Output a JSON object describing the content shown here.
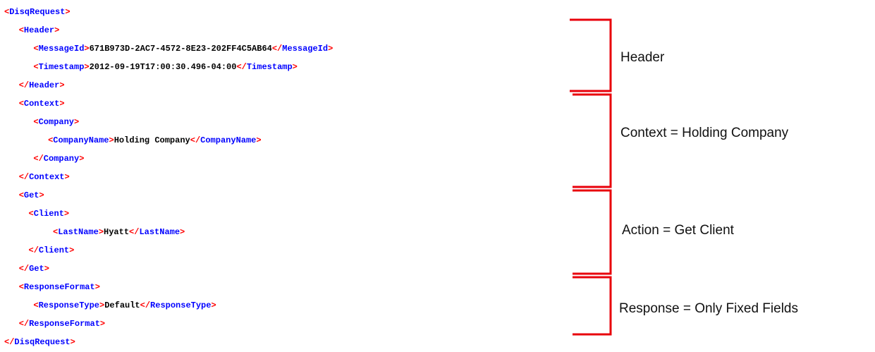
{
  "xml_lines": [
    {
      "indent": 0,
      "parts": [
        [
          "b",
          "<"
        ],
        [
          "t",
          "DisqRequest"
        ],
        [
          "b",
          ">"
        ]
      ]
    },
    {
      "indent": 3,
      "parts": [
        [
          "b",
          "<"
        ],
        [
          "t",
          "Header"
        ],
        [
          "b",
          ">"
        ]
      ]
    },
    {
      "indent": 6,
      "parts": [
        [
          "b",
          "<"
        ],
        [
          "t",
          "MessageId"
        ],
        [
          "b",
          ">"
        ],
        [
          "x",
          "671B973D-2AC7-4572-8E23-202FF4C5AB64"
        ],
        [
          "b",
          "</"
        ],
        [
          "t",
          "MessageId"
        ],
        [
          "b",
          ">"
        ]
      ]
    },
    {
      "indent": 6,
      "parts": [
        [
          "b",
          "<"
        ],
        [
          "t",
          "Timestamp"
        ],
        [
          "b",
          ">"
        ],
        [
          "x",
          "2012-09-19T17:00:30.496-04:00"
        ],
        [
          "b",
          "</"
        ],
        [
          "t",
          "Timestamp"
        ],
        [
          "b",
          ">"
        ]
      ]
    },
    {
      "indent": 3,
      "parts": [
        [
          "b",
          "</"
        ],
        [
          "t",
          "Header"
        ],
        [
          "b",
          ">"
        ]
      ]
    },
    {
      "indent": 3,
      "parts": [
        [
          "b",
          "<"
        ],
        [
          "t",
          "Context"
        ],
        [
          "b",
          ">"
        ]
      ]
    },
    {
      "indent": 6,
      "parts": [
        [
          "b",
          "<"
        ],
        [
          "t",
          "Company"
        ],
        [
          "b",
          ">"
        ]
      ]
    },
    {
      "indent": 9,
      "parts": [
        [
          "b",
          "<"
        ],
        [
          "t",
          "CompanyName"
        ],
        [
          "b",
          ">"
        ],
        [
          "x",
          "Holding Company"
        ],
        [
          "b",
          "</"
        ],
        [
          "t",
          "CompanyName"
        ],
        [
          "b",
          ">"
        ]
      ]
    },
    {
      "indent": 6,
      "parts": [
        [
          "b",
          "</"
        ],
        [
          "t",
          "Company"
        ],
        [
          "b",
          ">"
        ]
      ]
    },
    {
      "indent": 3,
      "parts": [
        [
          "b",
          "</"
        ],
        [
          "t",
          "Context"
        ],
        [
          "b",
          ">"
        ]
      ]
    },
    {
      "indent": 3,
      "parts": [
        [
          "b",
          "<"
        ],
        [
          "t",
          "Get"
        ],
        [
          "b",
          ">"
        ]
      ]
    },
    {
      "indent": 5,
      "parts": [
        [
          "b",
          "<"
        ],
        [
          "t",
          "Client"
        ],
        [
          "b",
          ">"
        ]
      ]
    },
    {
      "indent": 10,
      "parts": [
        [
          "b",
          "<"
        ],
        [
          "t",
          "LastName"
        ],
        [
          "b",
          ">"
        ],
        [
          "x",
          "Hyatt"
        ],
        [
          "b",
          "</"
        ],
        [
          "t",
          "LastName"
        ],
        [
          "b",
          ">"
        ]
      ]
    },
    {
      "indent": 5,
      "parts": [
        [
          "b",
          "</"
        ],
        [
          "t",
          "Client"
        ],
        [
          "b",
          ">"
        ]
      ]
    },
    {
      "indent": 3,
      "parts": [
        [
          "b",
          "</"
        ],
        [
          "t",
          "Get"
        ],
        [
          "b",
          ">"
        ]
      ]
    },
    {
      "indent": 3,
      "parts": [
        [
          "b",
          "<"
        ],
        [
          "t",
          "ResponseFormat"
        ],
        [
          "b",
          ">"
        ]
      ]
    },
    {
      "indent": 6,
      "parts": [
        [
          "b",
          "<"
        ],
        [
          "t",
          "ResponseType"
        ],
        [
          "b",
          ">"
        ],
        [
          "x",
          "Default"
        ],
        [
          "b",
          "</"
        ],
        [
          "t",
          "ResponseType"
        ],
        [
          "b",
          ">"
        ]
      ]
    },
    {
      "indent": 3,
      "parts": [
        [
          "b",
          "</"
        ],
        [
          "t",
          "ResponseFormat"
        ],
        [
          "b",
          ">"
        ]
      ]
    },
    {
      "indent": 0,
      "parts": [
        [
          "b",
          "</"
        ],
        [
          "t",
          "DisqRequest"
        ],
        [
          "b",
          ">"
        ]
      ]
    }
  ],
  "annotations": [
    {
      "label": "Header"
    },
    {
      "label": "Context = Holding Company"
    },
    {
      "label": "Action = Get Client"
    },
    {
      "label": "Response = Only Fixed Fields"
    }
  ],
  "colors": {
    "tag": "#0000ff",
    "bracket_punct": "#ff0000",
    "text": "#000000",
    "annotation_bracket": "#e8000b",
    "label": "#111111"
  }
}
